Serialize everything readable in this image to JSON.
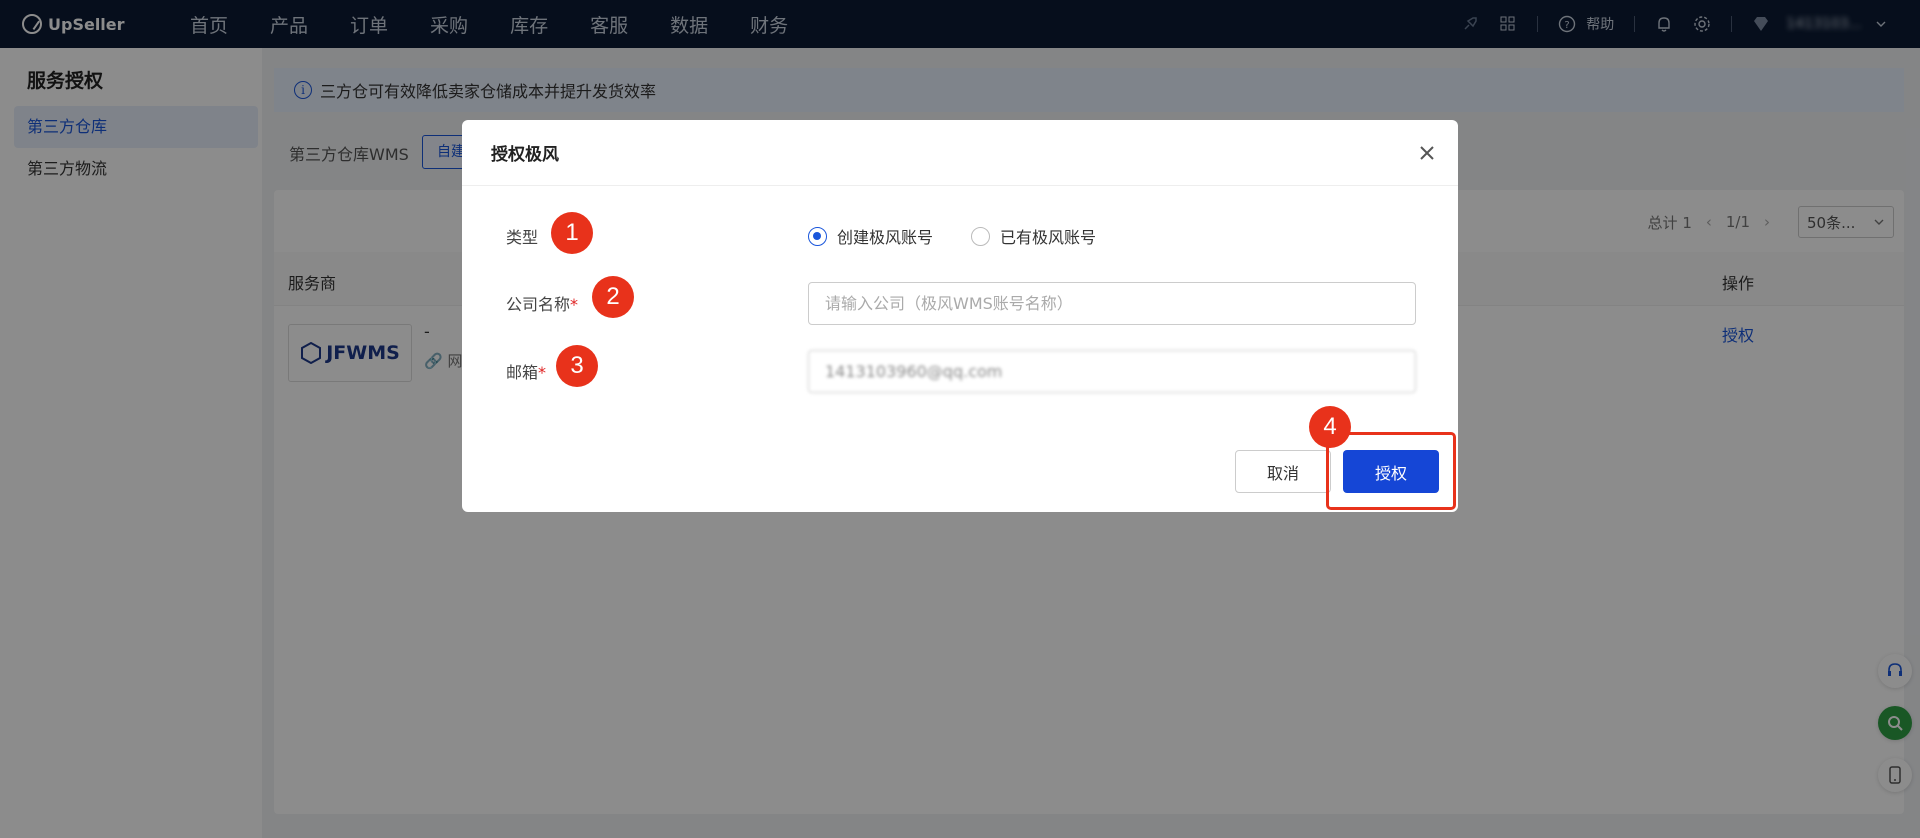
{
  "app": {
    "logo_text": "UpSeller"
  },
  "topnav": {
    "items": [
      "首页",
      "产品",
      "订单",
      "采购",
      "库存",
      "客服",
      "数据",
      "财务"
    ],
    "help_label": "帮助",
    "user_name": "1413103..."
  },
  "sidebar": {
    "title": "服务授权",
    "items": [
      {
        "label": "第三方仓库",
        "active": true
      },
      {
        "label": "第三方物流",
        "active": false
      }
    ]
  },
  "main": {
    "banner_text": "三方仓可有效降低卖家仓储成本并提升发货效率",
    "filter_label": "第三方仓库WMS",
    "filter_button": "自建",
    "pager": {
      "total": "总计 1",
      "page": "1/1",
      "page_size": "50条..."
    },
    "table": {
      "headers": {
        "provider": "服务商",
        "action": "操作"
      },
      "row": {
        "logo_text": "JFWMS",
        "dash": "-",
        "link_text": "网",
        "action": "授权"
      }
    }
  },
  "modal": {
    "title": "授权极风",
    "fields": {
      "type_label": "类型",
      "company_label": "公司名称",
      "email_label": "邮箱",
      "required_mark": "*"
    },
    "radios": [
      {
        "label": "创建极风账号",
        "checked": true
      },
      {
        "label": "已有极风账号",
        "checked": false
      }
    ],
    "company_placeholder": "请输入公司（极风WMS账号名称）",
    "email_value": "1413103960@qq.com",
    "cancel_label": "取消",
    "authorize_label": "授权"
  },
  "annotations": {
    "badges": [
      "1",
      "2",
      "3",
      "4"
    ],
    "highlight_color": "#e8321b"
  },
  "colors": {
    "primary": "#1546d6",
    "nav_bg": "#0b1a33",
    "badge": "#e8321b"
  }
}
